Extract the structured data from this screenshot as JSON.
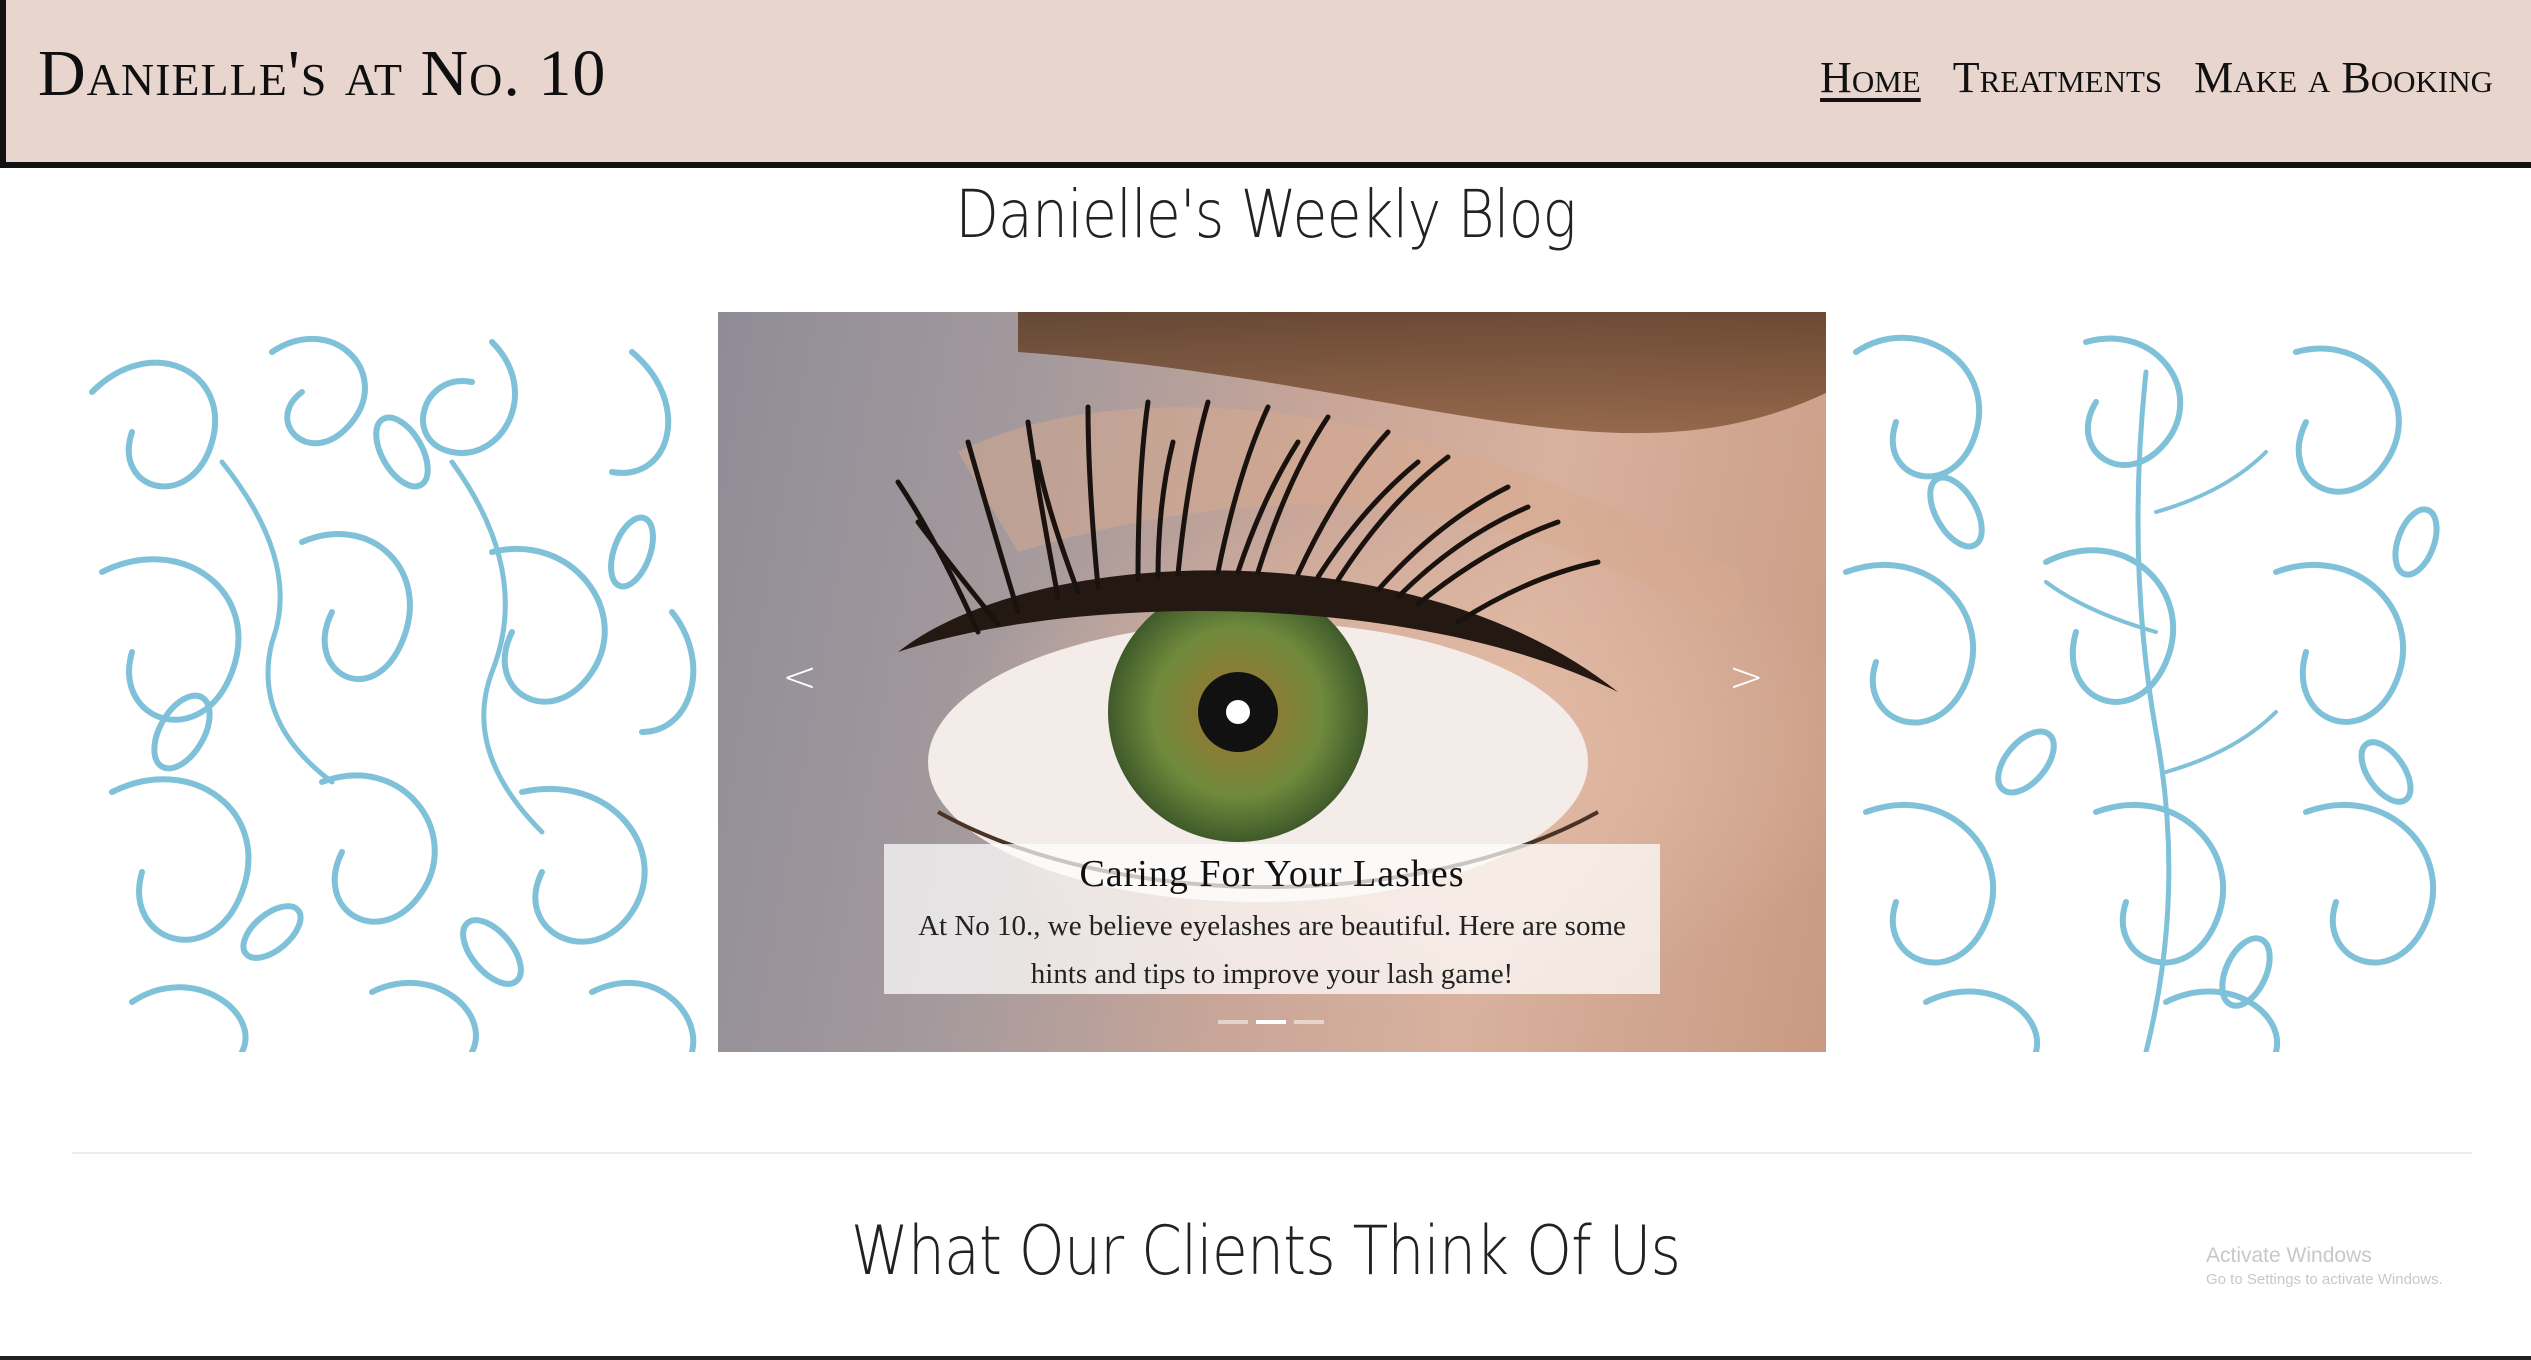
{
  "header": {
    "brand": "Danielle's at No. 10",
    "nav": [
      {
        "label": "Home",
        "active": true
      },
      {
        "label": "Treatments",
        "active": false
      },
      {
        "label": "Make a Booking",
        "active": false
      }
    ]
  },
  "blog": {
    "title": "Danielle's Weekly Blog"
  },
  "carousel": {
    "prev": "<",
    "next": ">",
    "caption_title": "Caring For Your Lashes",
    "caption_text": "At No 10., we believe eyelashes are beautiful. Here are some hints and tips to improve your lash game!",
    "slide_count": 3,
    "active_index": 1
  },
  "testimonials": {
    "title": "What Our Clients Think Of Us"
  },
  "watermark": {
    "title": "Activate Windows",
    "subtitle": "Go to Settings to activate Windows."
  },
  "colors": {
    "header_bg": "#e8d5ce",
    "floral": "#7fc1d9",
    "iris": "#6f8a3c"
  }
}
